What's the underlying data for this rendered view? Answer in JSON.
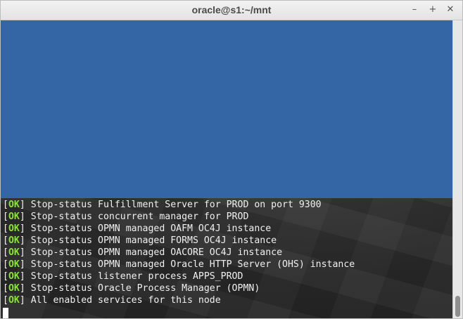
{
  "window": {
    "title": "oracle@s1:~/mnt",
    "buttons": {
      "minimize": "–",
      "maximize": "+",
      "close": "✕"
    }
  },
  "terminal": {
    "status_open": "[",
    "status_ok": "OK",
    "status_close": "]",
    "lines": [
      " Stop-status Fulfillment Server for PROD on port 9300",
      " Stop-status concurrent manager for PROD",
      " Stop-status OPMN managed OAFM OC4J instance",
      " Stop-status OPMN managed FORMS OC4J instance",
      " Stop-status OPMN managed OACORE OC4J instance",
      " Stop-status OPMN managed Oracle HTTP Server (OHS) instance",
      " Stop-status listener process APPS_PROD",
      " Stop-status Oracle Process Manager (OPMN)",
      " All enabled services for this node"
    ],
    "colors": {
      "blue_block": "#3465a4",
      "ok": "#8ae234",
      "text": "#f0f0f0"
    }
  }
}
